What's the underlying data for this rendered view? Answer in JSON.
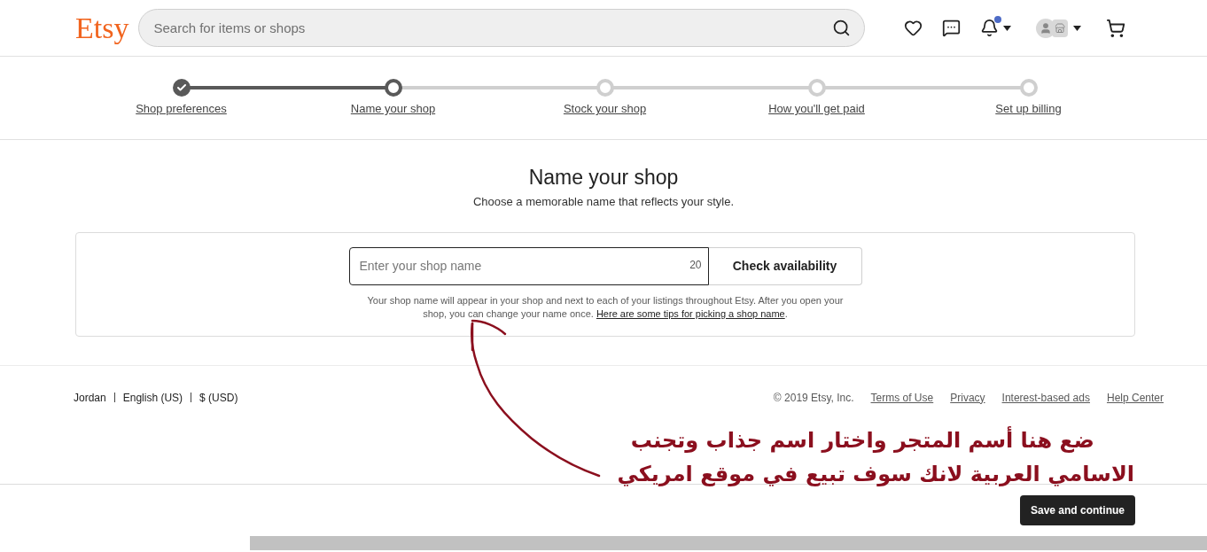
{
  "header": {
    "logo": "Etsy",
    "search": {
      "placeholder": "Search for items or shops"
    },
    "notifications": {
      "unread": true
    }
  },
  "steps": [
    {
      "label": "Shop preferences",
      "kind": "done"
    },
    {
      "label": "Name your shop",
      "kind": "current"
    },
    {
      "label": "Stock your shop",
      "kind": "upcoming"
    },
    {
      "label": "How you'll get paid",
      "kind": "upcoming"
    },
    {
      "label": "Set up billing",
      "kind": "upcoming"
    }
  ],
  "main": {
    "title": "Name your shop",
    "subtitle": "Choose a memorable name that reflects your style.",
    "field": {
      "placeholder": "Enter your shop name",
      "counter": "20"
    },
    "button": "Check availability",
    "help": {
      "text": "Your shop name will appear in your shop and next to each of your listings throughout Etsy. After you open your shop, you can change your name once.",
      "link": "Here are some tips for picking a shop name",
      "end": "."
    }
  },
  "footer": {
    "region": [
      "Jordan",
      "English (US)",
      "$ (USD)"
    ],
    "copyright": "© 2019 Etsy, Inc.",
    "links": [
      "Terms of Use",
      "Privacy",
      "Interest-based ads",
      "Help Center"
    ]
  },
  "bottom_bar": {
    "button": "Save and continue"
  },
  "annotation": {
    "lines": [
      "ضع هنا أسم المتجر واختار اسم جذاب وتجنب",
      "الاسامي العربية لانك سوف تبيع في موقع امريكي"
    ]
  }
}
